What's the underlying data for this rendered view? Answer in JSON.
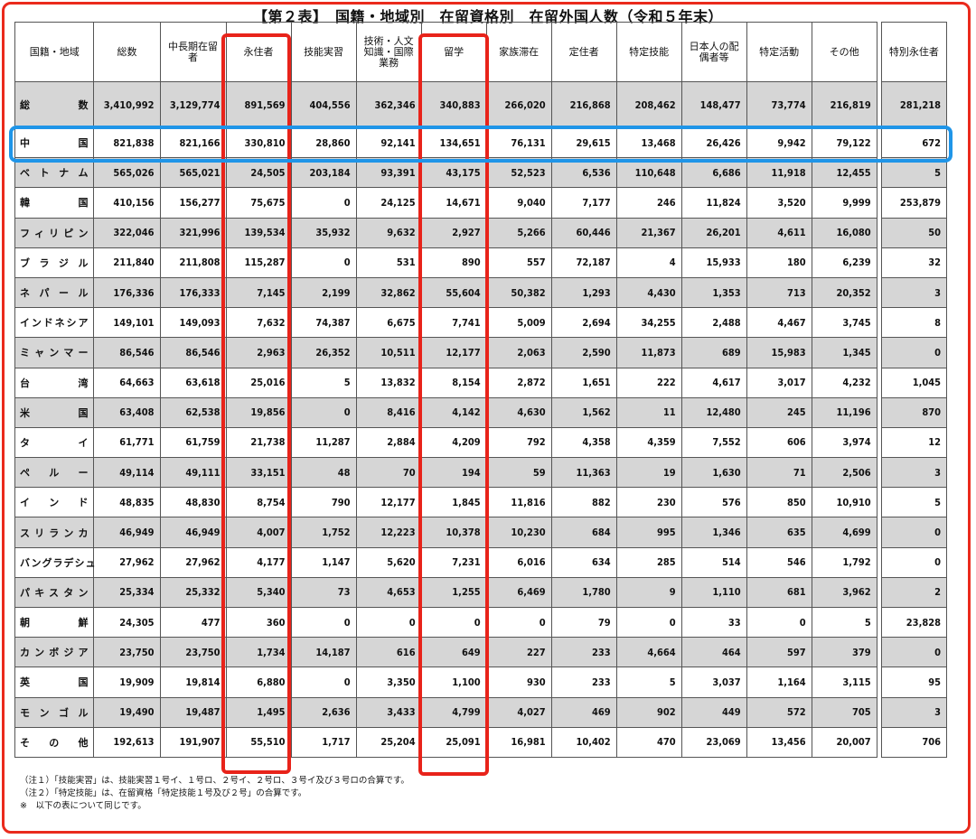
{
  "title": "【第２表】　国籍・地域別　在留資格別　在留外国人数（令和５年末）",
  "headers": {
    "region": "国籍・地域",
    "total": "総数",
    "midlong": "中長期在留者",
    "permanent": "永住者",
    "trainee": "技能実習",
    "engineer": "技術・人文知識・国際業務",
    "student": "留学",
    "family": "家族滞在",
    "longterm": "定住者",
    "specified": "特定技能",
    "spouse": "日本人の配偶者等",
    "designated": "特定活動",
    "other": "その他",
    "special": "特別永住者"
  },
  "total_row": [
    "総　　数",
    "3,410,992",
    "3,129,774",
    "891,569",
    "404,556",
    "362,346",
    "340,883",
    "266,020",
    "216,868",
    "208,462",
    "148,477",
    "73,774",
    "216,819",
    "281,218"
  ],
  "rows": [
    [
      "中国",
      "821,838",
      "821,166",
      "330,810",
      "28,860",
      "92,141",
      "134,651",
      "76,131",
      "29,615",
      "13,468",
      "26,426",
      "9,942",
      "79,122",
      "672"
    ],
    [
      "ベトナム",
      "565,026",
      "565,021",
      "24,505",
      "203,184",
      "93,391",
      "43,175",
      "52,523",
      "6,536",
      "110,648",
      "6,686",
      "11,918",
      "12,455",
      "5"
    ],
    [
      "韓国",
      "410,156",
      "156,277",
      "75,675",
      "0",
      "24,125",
      "14,671",
      "9,040",
      "7,177",
      "246",
      "11,824",
      "3,520",
      "9,999",
      "253,879"
    ],
    [
      "フィリピン",
      "322,046",
      "321,996",
      "139,534",
      "35,932",
      "9,632",
      "2,927",
      "5,266",
      "60,446",
      "21,367",
      "26,201",
      "4,611",
      "16,080",
      "50"
    ],
    [
      "ブラジル",
      "211,840",
      "211,808",
      "115,287",
      "0",
      "531",
      "890",
      "557",
      "72,187",
      "4",
      "15,933",
      "180",
      "6,239",
      "32"
    ],
    [
      "ネパール",
      "176,336",
      "176,333",
      "7,145",
      "2,199",
      "32,862",
      "55,604",
      "50,382",
      "1,293",
      "4,430",
      "1,353",
      "713",
      "20,352",
      "3"
    ],
    [
      "インドネシア",
      "149,101",
      "149,093",
      "7,632",
      "74,387",
      "6,675",
      "7,741",
      "5,009",
      "2,694",
      "34,255",
      "2,488",
      "4,467",
      "3,745",
      "8"
    ],
    [
      "ミャンマー",
      "86,546",
      "86,546",
      "2,963",
      "26,352",
      "10,511",
      "12,177",
      "2,063",
      "2,590",
      "11,873",
      "689",
      "15,983",
      "1,345",
      "0"
    ],
    [
      "台湾",
      "64,663",
      "63,618",
      "25,016",
      "5",
      "13,832",
      "8,154",
      "2,872",
      "1,651",
      "222",
      "4,617",
      "3,017",
      "4,232",
      "1,045"
    ],
    [
      "米国",
      "63,408",
      "62,538",
      "19,856",
      "0",
      "8,416",
      "4,142",
      "4,630",
      "1,562",
      "11",
      "12,480",
      "245",
      "11,196",
      "870"
    ],
    [
      "タイ",
      "61,771",
      "61,759",
      "21,738",
      "11,287",
      "2,884",
      "4,209",
      "792",
      "4,358",
      "4,359",
      "7,552",
      "606",
      "3,974",
      "12"
    ],
    [
      "ペルー",
      "49,114",
      "49,111",
      "33,151",
      "48",
      "70",
      "194",
      "59",
      "11,363",
      "19",
      "1,630",
      "71",
      "2,506",
      "3"
    ],
    [
      "インド",
      "48,835",
      "48,830",
      "8,754",
      "790",
      "12,177",
      "1,845",
      "11,816",
      "882",
      "230",
      "576",
      "850",
      "10,910",
      "5"
    ],
    [
      "スリランカ",
      "46,949",
      "46,949",
      "4,007",
      "1,752",
      "12,223",
      "10,378",
      "10,230",
      "684",
      "995",
      "1,346",
      "635",
      "4,699",
      "0"
    ],
    [
      "バングラデシュ",
      "27,962",
      "27,962",
      "4,177",
      "1,147",
      "5,620",
      "7,231",
      "6,016",
      "634",
      "285",
      "514",
      "546",
      "1,792",
      "0"
    ],
    [
      "パキスタン",
      "25,334",
      "25,332",
      "5,340",
      "73",
      "4,653",
      "1,255",
      "6,469",
      "1,780",
      "9",
      "1,110",
      "681",
      "3,962",
      "2"
    ],
    [
      "朝鮮",
      "24,305",
      "477",
      "360",
      "0",
      "0",
      "0",
      "0",
      "79",
      "0",
      "33",
      "0",
      "5",
      "23,828"
    ],
    [
      "カンボジア",
      "23,750",
      "23,750",
      "1,734",
      "14,187",
      "616",
      "649",
      "227",
      "233",
      "4,664",
      "464",
      "597",
      "379",
      "0"
    ],
    [
      "英国",
      "19,909",
      "19,814",
      "6,880",
      "0",
      "3,350",
      "1,100",
      "930",
      "233",
      "5",
      "3,037",
      "1,164",
      "3,115",
      "95"
    ],
    [
      "モンゴル",
      "19,490",
      "19,487",
      "1,495",
      "2,636",
      "3,433",
      "4,799",
      "4,027",
      "469",
      "902",
      "449",
      "572",
      "705",
      "3"
    ],
    [
      "その他",
      "192,613",
      "191,907",
      "55,510",
      "1,717",
      "25,204",
      "25,091",
      "16,981",
      "10,402",
      "470",
      "23,069",
      "13,456",
      "20,007",
      "706"
    ]
  ],
  "notes": [
    "（注１）「技能実習」は、技能実習１号イ、１号ロ、２号イ、２号ロ、３号イ及び３号ロの合算です。",
    "（注２）「特定技能」は、在留資格「特定技能１号及び２号」の合算です。",
    "※　以下の表について同じです。"
  ],
  "colors": {
    "highlight_red": "#e8231a",
    "highlight_blue": "#1f95e8",
    "shade": "#d6d6d6"
  }
}
